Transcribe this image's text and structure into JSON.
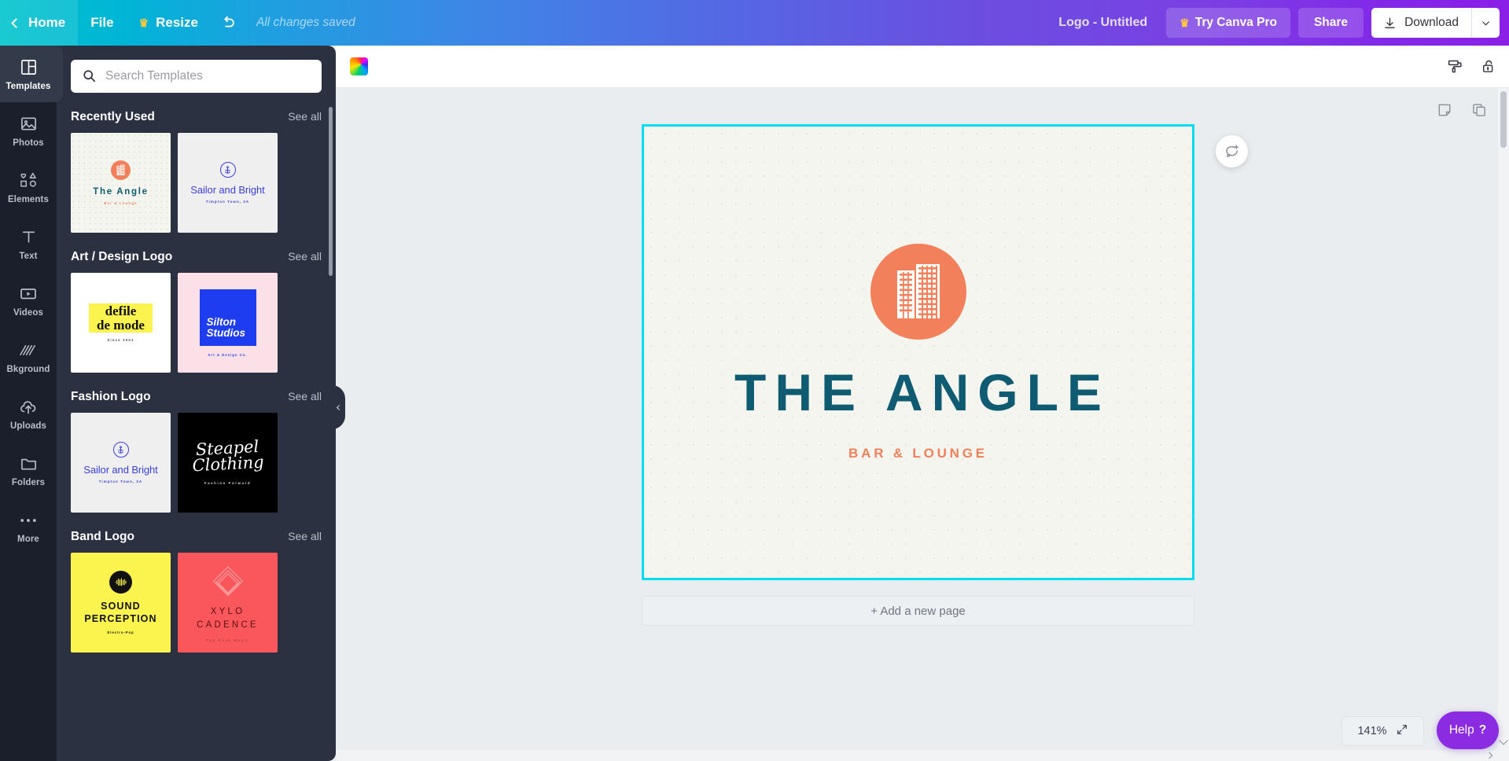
{
  "topbar": {
    "home_label": "Home",
    "file_label": "File",
    "resize_label": "Resize",
    "resize_icon": "crown-icon",
    "undo_icon": "undo-arrow-icon",
    "save_status": "All changes saved",
    "doc_title": "Logo - Untitled",
    "try_pro_label": "Try Canva Pro",
    "try_pro_icon": "crown-icon",
    "share_label": "Share",
    "download_label": "Download",
    "download_icon": "download-arrow-icon",
    "download_caret_icon": "chevron-down-icon",
    "gradient_start": "#00c4cc",
    "gradient_end": "#8b1fe8"
  },
  "rail": {
    "items": [
      {
        "label": "Templates",
        "icon": "templates-grid-icon",
        "active": true
      },
      {
        "label": "Photos",
        "icon": "photo-icon",
        "active": false
      },
      {
        "label": "Elements",
        "icon": "shapes-icon",
        "active": false
      },
      {
        "label": "Text",
        "icon": "text-t-icon",
        "active": false
      },
      {
        "label": "Videos",
        "icon": "video-play-icon",
        "active": false
      },
      {
        "label": "Bkground",
        "icon": "hatch-pattern-icon",
        "active": false
      },
      {
        "label": "Uploads",
        "icon": "cloud-upload-icon",
        "active": false
      },
      {
        "label": "Folders",
        "icon": "folder-icon",
        "active": false
      },
      {
        "label": "More",
        "icon": "ellipsis-icon",
        "active": false
      }
    ]
  },
  "panel": {
    "search_placeholder": "Search Templates",
    "search_value": "",
    "search_icon": "search-icon",
    "see_all_label": "See all",
    "collapse_icon": "chevron-left-icon",
    "sections": [
      {
        "title": "Recently Used",
        "templates": [
          {
            "name": "The Angle",
            "tagline": "Bar & Lounge",
            "style": "angle"
          },
          {
            "name": "Sailor and Bright",
            "tagline": "Timpton Town, 3A",
            "style": "sailor"
          }
        ]
      },
      {
        "title": "Art / Design Logo",
        "templates": [
          {
            "name": "defile de mode",
            "tagline": "Since 2001",
            "style": "defile"
          },
          {
            "name": "Silton Studios",
            "tagline": "Art & Design Co.",
            "style": "silton"
          }
        ]
      },
      {
        "title": "Fashion Logo",
        "templates": [
          {
            "name": "Sailor and Bright",
            "tagline": "Timpton Town, 3A",
            "style": "sailor"
          },
          {
            "name": "Steapel Clothing",
            "tagline": "Fashion Forward",
            "style": "steapel"
          }
        ]
      },
      {
        "title": "Band Logo",
        "templates": [
          {
            "name": "Sound Perception",
            "tagline": "Electro-Pop",
            "style": "sound"
          },
          {
            "name": "Xylo Cadence",
            "tagline": "Pop Rock Music",
            "style": "xylo"
          }
        ]
      }
    ]
  },
  "design_bar": {
    "swatch_icon": "rainbow-color-swatch-icon",
    "paint_roller_icon": "paint-roller-icon",
    "lock_icon": "unlock-icon"
  },
  "stage": {
    "page_tools": [
      {
        "icon": "notes-page-icon",
        "name": "notes"
      },
      {
        "icon": "duplicate-page-icon",
        "name": "duplicate"
      },
      {
        "icon": "plus-icon",
        "name": "add-page"
      }
    ],
    "comment_icon": "add-comment-icon",
    "add_page_label": "+ Add a new page",
    "selection_color": "#00dcf0"
  },
  "canvas": {
    "background": "#f4f5ef",
    "mark_color": "#f2805a",
    "mark_icon": "building-skyscraper-icon",
    "title": "THE ANGLE",
    "title_color": "#0f5b72",
    "tagline": "BAR & LOUNGE",
    "tagline_color": "#f2805a"
  },
  "footer": {
    "zoom_level": "141%",
    "fit_icon": "expand-diagonal-icon",
    "help_label": "Help",
    "help_mark": "?",
    "help_color": "#8b2be2"
  }
}
